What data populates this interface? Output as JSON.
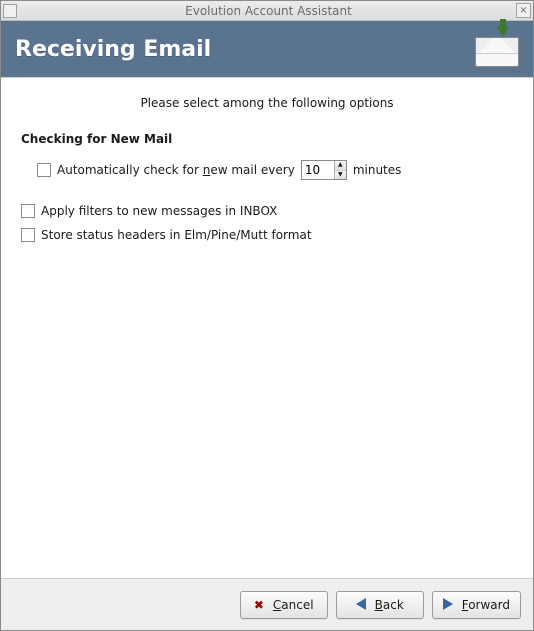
{
  "window": {
    "title": "Evolution Account Assistant"
  },
  "header": {
    "heading": "Receiving Email",
    "icon": "mail-receive-icon"
  },
  "intro": "Please select among the following options",
  "section": {
    "title": "Checking for New Mail",
    "autocheck": {
      "checked": false,
      "label_before": "Automatically check for ",
      "label_underlined": "n",
      "label_mid": "ew mail every",
      "value": "10",
      "label_after": "minutes"
    }
  },
  "options": [
    {
      "checked": false,
      "label": "Apply filters to new messages in INBOX"
    },
    {
      "checked": false,
      "label": "Store status headers in Elm/Pine/Mutt format"
    }
  ],
  "buttons": {
    "cancel": {
      "underlined": "C",
      "rest": "ancel"
    },
    "back": {
      "underlined": "B",
      "rest": "ack"
    },
    "forward": {
      "underlined": "F",
      "rest": "orward"
    }
  }
}
